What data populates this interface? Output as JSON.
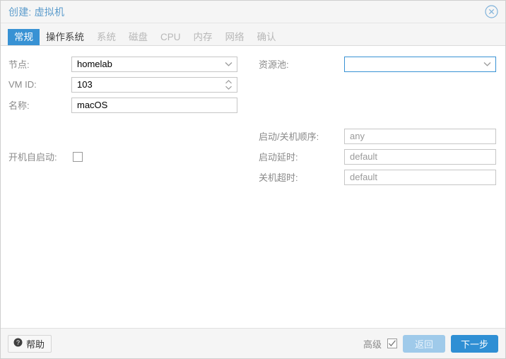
{
  "window": {
    "title": "创建: 虚拟机",
    "close_icon": "close-circle-icon"
  },
  "tabs": [
    {
      "label": "常规",
      "state": "active"
    },
    {
      "label": "操作系统",
      "state": "enabled"
    },
    {
      "label": "系统",
      "state": "disabled"
    },
    {
      "label": "磁盘",
      "state": "disabled"
    },
    {
      "label": "CPU",
      "state": "disabled"
    },
    {
      "label": "内存",
      "state": "disabled"
    },
    {
      "label": "网络",
      "state": "disabled"
    },
    {
      "label": "确认",
      "state": "disabled"
    }
  ],
  "form": {
    "left": {
      "node": {
        "label": "节点:",
        "value": "homelab",
        "icon": "chevron-down-icon"
      },
      "vmid": {
        "label": "VM ID:",
        "value": "103",
        "icon": "spinner-icon"
      },
      "name": {
        "label": "名称:",
        "value": "macOS"
      },
      "autostart": {
        "label": "开机自启动:",
        "checked": false
      }
    },
    "right": {
      "pool": {
        "label": "资源池:",
        "value": "",
        "icon": "chevron-down-icon",
        "focused": true
      },
      "order": {
        "label": "启动/关机顺序:",
        "placeholder": "any"
      },
      "startup": {
        "label": "启动延时:",
        "placeholder": "default"
      },
      "shutdown": {
        "label": "关机超时:",
        "placeholder": "default"
      }
    }
  },
  "footer": {
    "help": {
      "label": "帮助",
      "icon": "help-circle-icon"
    },
    "advanced": {
      "label": "高级",
      "checked": true
    },
    "back_label": "返回",
    "next_label": "下一步"
  },
  "colors": {
    "accent": "#3892d4",
    "primary_button": "#2f8fd4",
    "disabled_button": "#9fcaea",
    "title_text": "#5c9ccc",
    "label_text": "#8a8a8a",
    "panel_background": "#f5f5f5"
  }
}
